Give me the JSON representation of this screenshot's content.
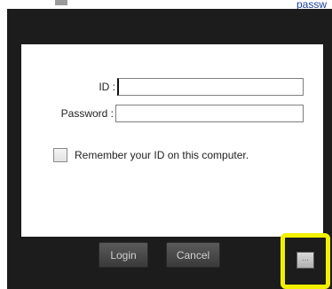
{
  "background": {
    "link_fragment": "passw"
  },
  "login_form": {
    "id_label": "ID :",
    "id_value": "",
    "password_label": "Password :",
    "password_value": "",
    "remember_label": "Remember your ID on this computer.",
    "remember_checked": false
  },
  "buttons": {
    "login_label": "Login",
    "cancel_label": "Cancel",
    "more_label": "..."
  },
  "colors": {
    "dialog_background": "#1c1c1c",
    "panel_background": "#ffffff",
    "highlight": "#f0f000"
  }
}
